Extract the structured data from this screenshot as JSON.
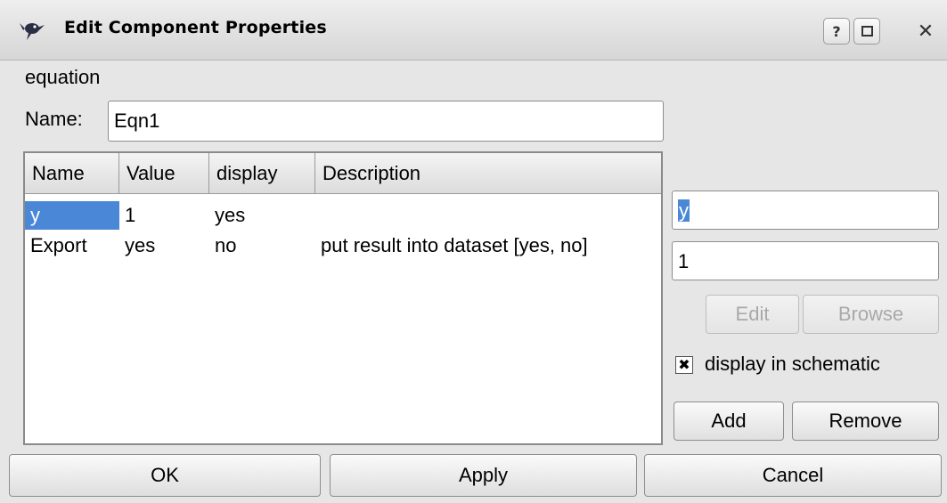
{
  "window": {
    "title": "Edit Component Properties",
    "help_label": "?",
    "close_label": "✕"
  },
  "component_type": "equation",
  "name_field": {
    "label": "Name:",
    "value": "Eqn1"
  },
  "properties_table": {
    "columns": [
      "Name",
      "Value",
      "display",
      "Description"
    ],
    "rows": [
      {
        "name": "y",
        "value": "1",
        "display": "yes",
        "description": ""
      },
      {
        "name": "Export",
        "value": "yes",
        "display": "no",
        "description": "put result into dataset [yes, no]"
      }
    ],
    "selected_row": 0
  },
  "editor": {
    "name_value": "y",
    "value_value": "1",
    "edit_label": "Edit",
    "browse_label": "Browse",
    "display_checkbox": {
      "label": "display in schematic",
      "checked": true,
      "mark": "✖"
    },
    "add_label": "Add",
    "remove_label": "Remove"
  },
  "buttons": {
    "ok": "OK",
    "apply": "Apply",
    "cancel": "Cancel"
  },
  "colors": {
    "selection": "#4a87d6",
    "background": "#e6e6e6"
  }
}
